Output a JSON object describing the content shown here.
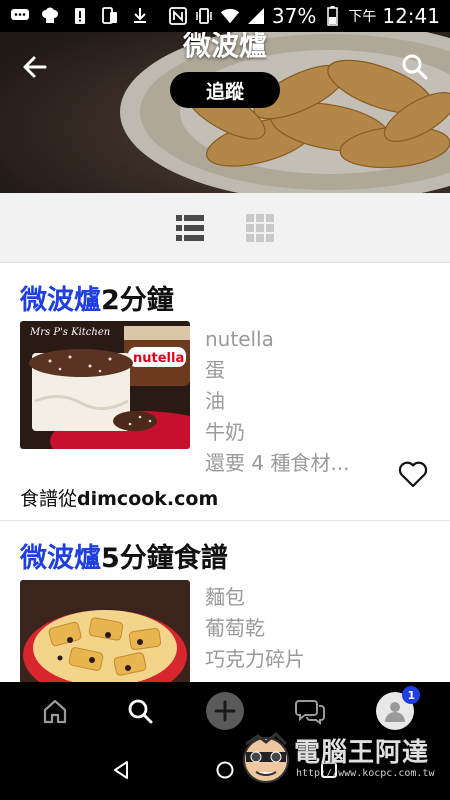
{
  "status_bar": {
    "battery": "37%",
    "time_period": "下午",
    "time": "12:41"
  },
  "header": {
    "title": "微波爐",
    "follow_label": "追蹤",
    "icons": [
      "back-arrow-icon",
      "search-icon"
    ]
  },
  "view_toggle": {
    "icons": [
      "list-view-icon",
      "grid-view-icon"
    ],
    "active": "list"
  },
  "recipes": [
    {
      "title_keyword": "微波爐",
      "title_rest": "2分鐘",
      "ingredients": [
        "nutella",
        "蛋",
        "油",
        "牛奶",
        "還要 4 種食材..."
      ],
      "source_prefix": "食譜從",
      "source_site": "dimcook.com",
      "image_caption": "Mrs P's Kitchen",
      "image_brand": "nutella"
    },
    {
      "title_keyword": "微波爐",
      "title_rest": "5分鐘食譜",
      "ingredients": [
        "麵包",
        "葡萄乾",
        "巧克力碎片"
      ]
    }
  ],
  "bottom_nav": {
    "items": [
      "home-icon",
      "search-icon",
      "add-icon",
      "chat-icon",
      "profile-icon"
    ],
    "badge_count": "1"
  },
  "watermark": {
    "text": "電腦王阿達",
    "url": "http://www.kocpc.com.tw"
  },
  "colors": {
    "keyword_blue": "#1f3fe0",
    "ingredient_gray": "#9a9a9a",
    "bar_black": "#000000"
  }
}
